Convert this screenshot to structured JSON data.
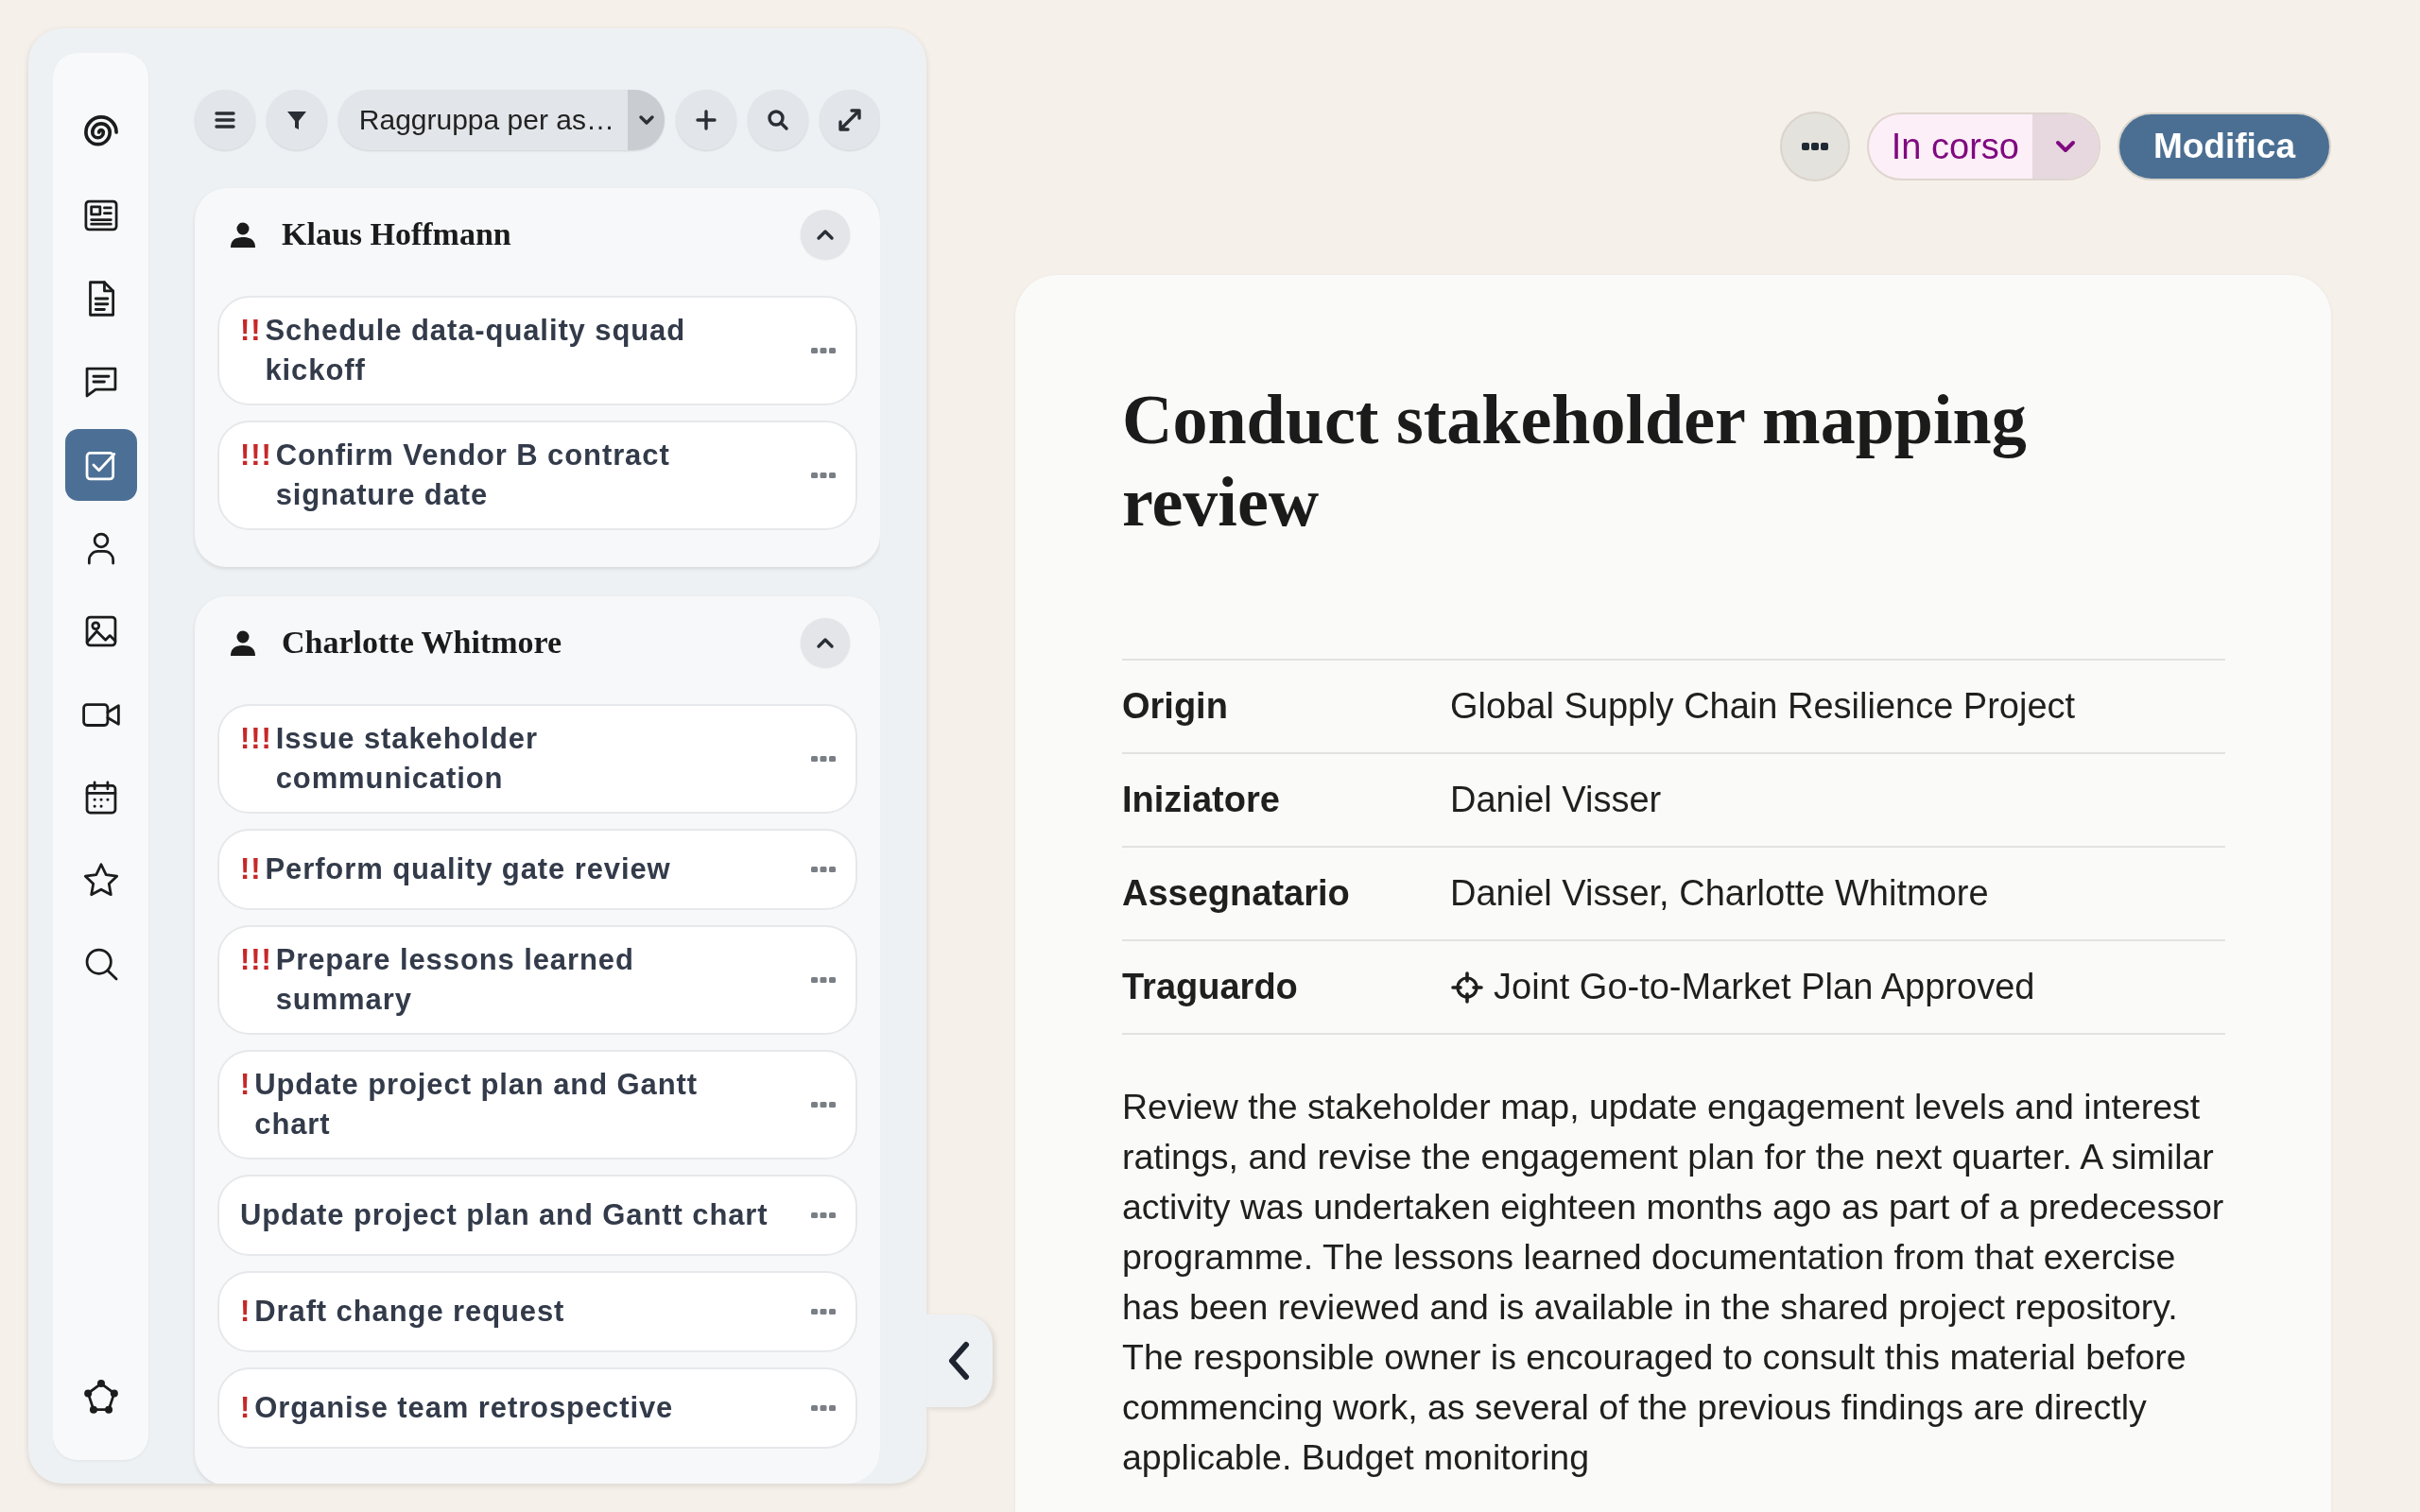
{
  "rail": {
    "items": [
      {
        "kind": "spiral",
        "selected": false
      },
      {
        "kind": "news",
        "selected": false
      },
      {
        "kind": "document",
        "selected": false
      },
      {
        "kind": "chat",
        "selected": false
      },
      {
        "kind": "tasks",
        "selected": true
      },
      {
        "kind": "person",
        "selected": false
      },
      {
        "kind": "image",
        "selected": false
      },
      {
        "kind": "video",
        "selected": false
      },
      {
        "kind": "calendar",
        "selected": false
      },
      {
        "kind": "star",
        "selected": false
      },
      {
        "kind": "search",
        "selected": false
      }
    ],
    "bottom": {
      "kind": "network",
      "selected": false
    }
  },
  "toolbar": {
    "group_by": "Raggruppa per as…"
  },
  "groups": [
    {
      "name": "Klaus Hoffmann",
      "expanded": true,
      "tasks": [
        {
          "priority": "!!",
          "title": "Schedule data-quality squad kickoff"
        },
        {
          "priority": "!!!",
          "title": "Confirm Vendor B contract signature date"
        }
      ]
    },
    {
      "name": "Charlotte Whitmore",
      "expanded": true,
      "tasks": [
        {
          "priority": "!!!",
          "title": "Issue stakeholder communication"
        },
        {
          "priority": "!!",
          "title": "Perform quality gate review"
        },
        {
          "priority": "!!!",
          "title": "Prepare lessons learned summary"
        },
        {
          "priority": "!",
          "title": "Update project plan and Gantt chart"
        },
        {
          "title": "Update project plan and Gantt chart"
        },
        {
          "priority": "!",
          "title": "Draft change request"
        },
        {
          "priority": "!",
          "title": "Organise team retrospective"
        }
      ]
    }
  ],
  "actions": {
    "status": "In corso",
    "edit": "Modifica"
  },
  "detail": {
    "title": "Conduct stakeholder mapping review",
    "fields": [
      {
        "label": "Origin",
        "value": "Global Supply Chain Resilience Project"
      },
      {
        "label": "Iniziatore",
        "value": "Daniel Visser"
      },
      {
        "label": "Assegnatario",
        "value": "Daniel Visser, Charlotte Whitmore"
      },
      {
        "label": "Traguardo",
        "value": "Joint Go-to-Market Plan Approved",
        "kind": "milestone"
      }
    ],
    "description": "Review the stakeholder map, update engagement levels and interest ratings, and revise the engagement plan for the next quarter. A similar activity was undertaken eighteen months ago as part of a predecessor programme. The lessons learned documentation from that exercise has been reviewed and is available in the shared project repository. The responsible owner is encouraged to consult this material before commencing work, as several of the previous findings are directly applicable. Budget monitoring"
  }
}
